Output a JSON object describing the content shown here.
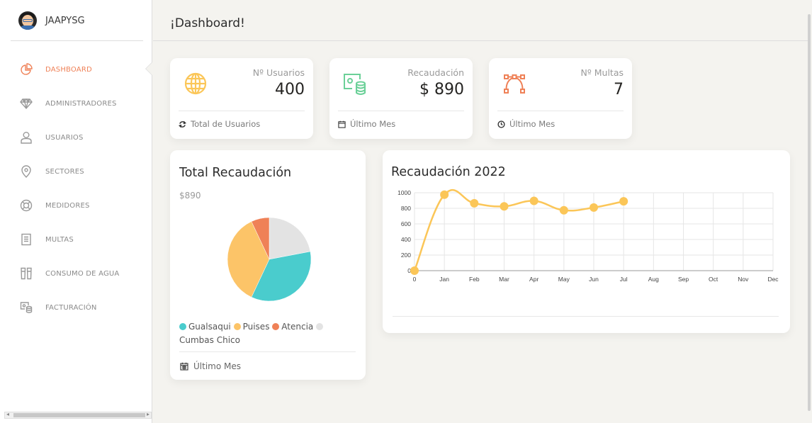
{
  "brand": {
    "name": "JAAPYSG"
  },
  "header": {
    "title": "¡Dashboard!"
  },
  "sidebar": {
    "items": [
      {
        "label": "DASHBOARD",
        "icon": "pie-chart-icon",
        "active": true
      },
      {
        "label": "ADMINISTRADORES",
        "icon": "diamond-icon",
        "active": false
      },
      {
        "label": "USUARIOS",
        "icon": "user-icon",
        "active": false
      },
      {
        "label": "SECTORES",
        "icon": "map-pin-icon",
        "active": false
      },
      {
        "label": "MEDIDORES",
        "icon": "lifebuoy-icon",
        "active": false
      },
      {
        "label": "MULTAS",
        "icon": "paper-icon",
        "active": false
      },
      {
        "label": "CONSUMO DE AGUA",
        "icon": "glasses-icon",
        "active": false
      },
      {
        "label": "FACTURACIÓN",
        "icon": "money-coins-icon",
        "active": false
      }
    ]
  },
  "stats": [
    {
      "category": "Nº Usuarios",
      "value": "400",
      "footer": "Total de Usuarios",
      "icon": "globe-icon",
      "footer_icon": "refresh-icon",
      "color": "#fbc658"
    },
    {
      "category": "Recaudación",
      "value": "$ 890",
      "footer": "Último Mes",
      "icon": "money-coins-icon",
      "footer_icon": "calendar-icon",
      "color": "#6bd098"
    },
    {
      "category": "Nº Multas",
      "value": "7",
      "footer": "Último Mes",
      "icon": "vector-icon",
      "footer_icon": "clock-icon",
      "color": "#ef8157"
    }
  ],
  "pie_card": {
    "title": "Total Recaudación",
    "subtitle": "$890",
    "footer": "Último Mes",
    "legend": [
      {
        "label": "Gualsaqui",
        "color": "#4acccd"
      },
      {
        "label": "Puises",
        "color": "#fcc468"
      },
      {
        "label": "Atencia",
        "color": "#ef8157"
      },
      {
        "label": "Cumbas Chico",
        "color": "#e3e3e3"
      }
    ]
  },
  "line_card": {
    "title": "Recaudación 2022"
  },
  "chart_data": [
    {
      "type": "pie",
      "categories": [
        "Gualsaqui",
        "Puises",
        "Atencia",
        "Cumbas Chico"
      ],
      "values": [
        35,
        36,
        7,
        22
      ],
      "colors": [
        "#4acccd",
        "#fcc468",
        "#ef8157",
        "#e3e3e3"
      ]
    },
    {
      "type": "line",
      "categories": [
        "0",
        "Jan",
        "Feb",
        "Mar",
        "Apr",
        "May",
        "Jun",
        "Jul",
        "Aug",
        "Sep",
        "Oct",
        "Nov",
        "Dec"
      ],
      "series": [
        {
          "values": [
            0,
            975,
            865,
            825,
            895,
            775,
            810,
            890
          ]
        }
      ],
      "yticks": [
        "0",
        "200",
        "400",
        "600",
        "800",
        "1000"
      ],
      "ylim": [
        0,
        1000
      ],
      "grid": true,
      "color": "#fbc658"
    }
  ]
}
